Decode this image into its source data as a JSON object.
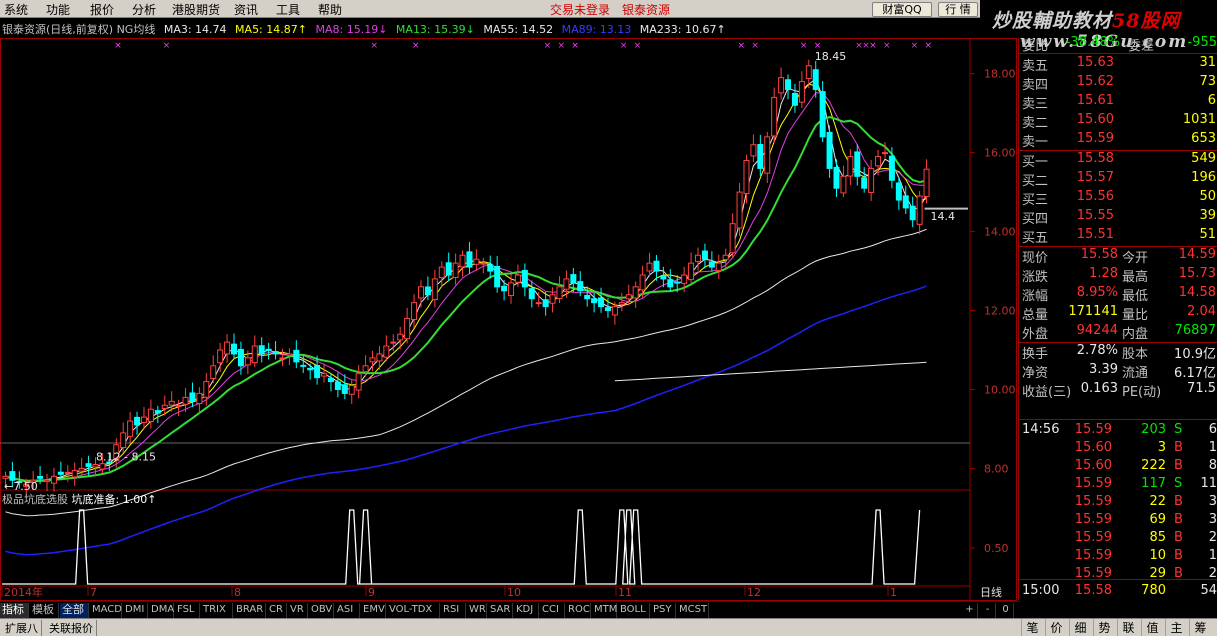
{
  "menu": {
    "items": [
      "系统",
      "功能",
      "报价",
      "分析",
      "港股期货",
      "资讯",
      "工具",
      "帮助"
    ],
    "trade_status": "交易未登录",
    "stock_name": "银泰资源",
    "btn_finance": "财富QQ",
    "btn_quote": "行 情"
  },
  "brand": {
    "line1_a": "炒股輔助教材",
    "line1_b": "58股网",
    "line2": "www.58Gu.com"
  },
  "chart_header": {
    "title": "银泰资源(日线,前复权) NG均线",
    "ma3": "MA3: 14.74",
    "ma5": "MA5: 14.87↑",
    "ma8": "MA8: 15.19↓",
    "ma13": "MA13: 15.39↓",
    "ma55": "MA55: 14.52",
    "ma89": "MA89: 13.13",
    "ma233": "MA233: 10.67↑"
  },
  "colors": {
    "ma3": "#e8e8e8",
    "ma5": "#ffff00",
    "ma8": "#e040e0",
    "ma13": "#33dd33",
    "ma55": "#e8e8e8",
    "ma89": "#2020ff",
    "ma233": "#e8e8e8",
    "up": "#ff4040",
    "down": "#00ffff"
  },
  "chart_data": {
    "type": "candlestick",
    "price_axis": [
      "18.00",
      "16.00",
      "14.00",
      "12.00",
      "10.00",
      "8.00"
    ],
    "price_range": [
      7.2,
      18.6
    ],
    "time_labels": [
      "2014年",
      "7",
      "8",
      "9",
      "10",
      "11",
      "12",
      "1"
    ],
    "annotations": {
      "high_label": "18.45",
      "low_label": "←7.50",
      "range_label": "8.12 - 8.15",
      "last_label": "14.4"
    },
    "period_label": "日线",
    "closes": [
      7.8,
      7.7,
      7.65,
      7.6,
      7.7,
      7.75,
      7.7,
      7.8,
      7.85,
      7.9,
      7.95,
      8.0,
      8.05,
      8.1,
      8.12,
      8.15,
      8.6,
      8.9,
      9.2,
      9.1,
      9.3,
      9.5,
      9.4,
      9.6,
      9.7,
      9.6,
      9.8,
      9.7,
      9.9,
      10.2,
      10.6,
      11.0,
      11.2,
      10.9,
      10.6,
      10.8,
      11.1,
      10.9,
      11.0,
      10.9,
      10.8,
      10.9,
      10.7,
      10.6,
      10.5,
      10.3,
      10.4,
      10.2,
      10.0,
      9.9,
      10.1,
      10.4,
      10.6,
      10.8,
      10.9,
      11.1,
      11.2,
      11.4,
      11.8,
      12.2,
      12.6,
      12.4,
      12.8,
      13.1,
      12.9,
      13.2,
      13.4,
      13.1,
      13.3,
      13.2,
      13.0,
      12.6,
      12.5,
      12.7,
      12.9,
      12.6,
      12.3,
      12.2,
      12.1,
      12.4,
      12.6,
      12.8,
      12.7,
      12.5,
      12.3,
      12.2,
      12.1,
      12.0,
      12.1,
      12.2,
      12.4,
      12.6,
      12.9,
      13.2,
      13.0,
      12.8,
      12.6,
      12.7,
      12.9,
      13.2,
      13.4,
      13.3,
      13.1,
      13.2,
      13.4,
      14.2,
      15.0,
      15.8,
      16.2,
      15.6,
      16.4,
      17.4,
      17.9,
      17.6,
      17.2,
      17.8,
      18.2,
      17.6,
      16.4,
      15.6,
      15.1,
      15.4,
      15.9,
      15.4,
      15.1,
      15.6,
      15.9,
      16.0,
      15.3,
      14.8,
      14.6,
      14.3,
      14.9,
      15.58
    ],
    "ma_lines": {
      "ma13": "green",
      "ma55": "white",
      "ma89": "blue",
      "ma233": "white"
    }
  },
  "sub_chart": {
    "title": "极品坑底选股",
    "value": "坑底准备: 1.00↑",
    "axis": [
      "0.50"
    ],
    "signals": [
      15,
      68,
      70,
      71,
      112,
      120,
      122,
      123,
      170,
      178
    ]
  },
  "quotes": {
    "top_label": "委比",
    "top_value": "-38.48%",
    "top_label2": "委差",
    "top_value2": "-955",
    "sells": [
      {
        "label": "卖五",
        "price": "15.63",
        "vol": "31"
      },
      {
        "label": "卖四",
        "price": "15.62",
        "vol": "73"
      },
      {
        "label": "卖三",
        "price": "15.61",
        "vol": "6"
      },
      {
        "label": "卖二",
        "price": "15.60",
        "vol": "1031"
      },
      {
        "label": "卖一",
        "price": "15.59",
        "vol": "653"
      }
    ],
    "buys": [
      {
        "label": "买一",
        "price": "15.58",
        "vol": "549"
      },
      {
        "label": "买二",
        "price": "15.57",
        "vol": "196"
      },
      {
        "label": "买三",
        "price": "15.56",
        "vol": "50"
      },
      {
        "label": "买四",
        "price": "15.55",
        "vol": "39"
      },
      {
        "label": "买五",
        "price": "15.51",
        "vol": "51"
      }
    ],
    "stats": [
      {
        "l1": "现价",
        "v1": "15.58",
        "c1": "red",
        "l2": "今开",
        "v2": "14.59",
        "c2": "red"
      },
      {
        "l1": "涨跌",
        "v1": "1.28",
        "c1": "red",
        "l2": "最高",
        "v2": "15.73",
        "c2": "red"
      },
      {
        "l1": "涨幅",
        "v1": "8.95%",
        "c1": "red",
        "l2": "最低",
        "v2": "14.58",
        "c2": "red"
      },
      {
        "l1": "总量",
        "v1": "171141",
        "c1": "yel",
        "l2": "量比",
        "v2": "2.04",
        "c2": "red"
      },
      {
        "l1": "外盘",
        "v1": "94244",
        "c1": "red",
        "l2": "内盘",
        "v2": "76897",
        "c2": "green"
      }
    ],
    "stats2": [
      {
        "l1": "换手",
        "v1": "2.78%",
        "l2": "股本",
        "v2": "10.9亿"
      },
      {
        "l1": "净资",
        "v1": "3.39",
        "l2": "流通",
        "v2": "6.17亿"
      },
      {
        "l1": "收益(三)",
        "v1": "0.163",
        "l2": "PE(动)",
        "v2": "71.5"
      }
    ],
    "ticks": [
      {
        "time": "14:56",
        "price": "15.59",
        "vol": "203",
        "side": "S",
        "n": "6"
      },
      {
        "time": "",
        "price": "15.60",
        "vol": "3",
        "side": "B",
        "n": "1"
      },
      {
        "time": "",
        "price": "15.60",
        "vol": "222",
        "side": "B",
        "n": "8"
      },
      {
        "time": "",
        "price": "15.59",
        "vol": "117",
        "side": "S",
        "n": "11"
      },
      {
        "time": "",
        "price": "15.59",
        "vol": "22",
        "side": "B",
        "n": "3"
      },
      {
        "time": "",
        "price": "15.59",
        "vol": "69",
        "side": "B",
        "n": "3"
      },
      {
        "time": "",
        "price": "15.59",
        "vol": "85",
        "side": "B",
        "n": "2"
      },
      {
        "time": "",
        "price": "15.59",
        "vol": "10",
        "side": "B",
        "n": "1"
      },
      {
        "time": "",
        "price": "15.59",
        "vol": "29",
        "side": "B",
        "n": "2"
      },
      {
        "time": "15:00",
        "price": "15.58",
        "vol": "780",
        "side": "",
        "n": "54"
      }
    ]
  },
  "tabs": {
    "left": [
      "指标",
      "模板",
      "全部"
    ],
    "indicators": [
      "MACD",
      "DMI",
      "DMA",
      "FSL",
      "TRIX",
      "BRAR",
      "CR",
      "VR",
      "OBV",
      "ASI",
      "EMV",
      "VOL-TDX",
      "RSI",
      "WR",
      "SAR",
      "KDJ",
      "CCI",
      "ROC",
      "MTM",
      "BOLL",
      "PSY",
      "MCST"
    ],
    "right": [
      "+",
      "-",
      "0"
    ]
  },
  "statusbar": {
    "left": [
      "扩展八",
      "关联报价"
    ],
    "right": [
      "笔",
      "价",
      "细",
      "势",
      "联",
      "值",
      "主",
      "筹"
    ]
  }
}
